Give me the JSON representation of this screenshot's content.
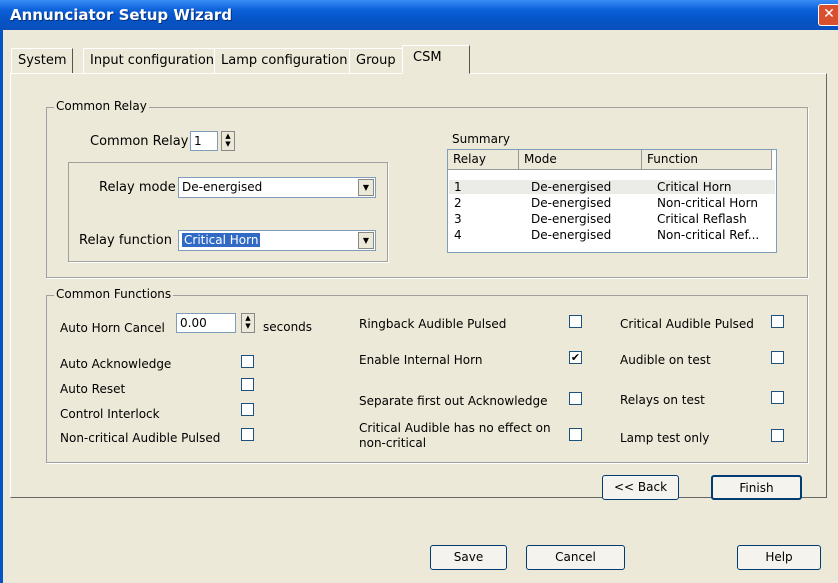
{
  "window": {
    "title": "Annunciator Setup Wizard",
    "close": "✕"
  },
  "tabs": [
    "System",
    "Input configuration",
    "Lamp configuration",
    "Group",
    "CSM"
  ],
  "common_relay": {
    "group_title": "Common Relay",
    "label": "Common Relay",
    "value": "1",
    "relay_mode_label": "Relay mode",
    "relay_mode_value": "De-energised",
    "relay_function_label": "Relay function",
    "relay_function_value": "Critical Horn",
    "summary_label": "Summary",
    "columns": [
      "Relay",
      "Mode",
      "Function"
    ],
    "rows": [
      [
        "1",
        "De-energised",
        "Critical Horn"
      ],
      [
        "2",
        "De-energised",
        "Non-critical Horn"
      ],
      [
        "3",
        "De-energised",
        "Critical Reflash"
      ],
      [
        "4",
        "De-energised",
        "Non-critical Ref..."
      ]
    ]
  },
  "common_functions": {
    "group_title": "Common Functions",
    "auto_horn_cancel_label": "Auto Horn Cancel",
    "auto_horn_cancel_value": "0.00",
    "seconds_label": "seconds",
    "auto_acknowledge": {
      "label": "Auto Acknowledge",
      "checked": false
    },
    "auto_reset": {
      "label": "Auto Reset",
      "checked": false
    },
    "control_interlock": {
      "label": "Control Interlock",
      "checked": false
    },
    "noncritical_audible_pulsed": {
      "label": "Non-critical Audible Pulsed",
      "checked": false
    },
    "ringback_audible_pulsed": {
      "label": "Ringback Audible Pulsed",
      "checked": false
    },
    "enable_internal_horn": {
      "label": "Enable Internal Horn",
      "checked": true
    },
    "separate_first_out_ack": {
      "label": "Separate first out Acknowledge",
      "checked": false
    },
    "critical_audible_no_effect_1": "Critical Audible has no effect on",
    "critical_audible_no_effect_2": "non-critical",
    "critical_audible_no_effect_checked": false,
    "critical_audible_pulsed": {
      "label": "Critical Audible Pulsed",
      "checked": false
    },
    "audible_on_test": {
      "label": "Audible on test",
      "checked": false
    },
    "relays_on_test": {
      "label": "Relays on test",
      "checked": false
    },
    "lamp_test_only": {
      "label": "Lamp test only",
      "checked": false
    }
  },
  "nav": {
    "back": "<< Back",
    "finish": "Finish"
  },
  "footer": {
    "save": "Save",
    "cancel": "Cancel",
    "help": "Help"
  },
  "glyphs": {
    "check": "✔",
    "dropdown": "▼",
    "spin_up": "▲",
    "spin_down": "▼"
  }
}
